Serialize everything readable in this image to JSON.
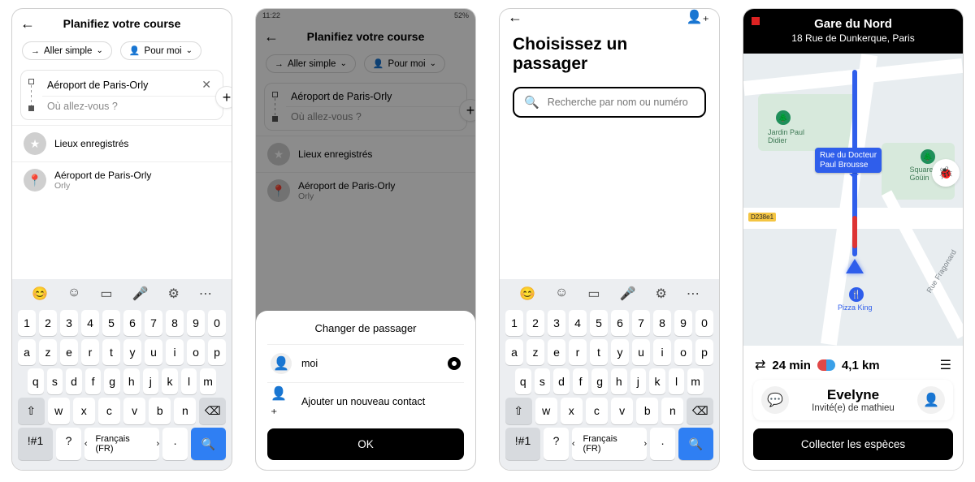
{
  "screen1": {
    "title": "Planifiez votre course",
    "chip_trip": "Aller simple",
    "chip_rider": "Pour moi",
    "origin": "Aéroport de Paris-Orly",
    "dest_placeholder": "Où allez-vous ?",
    "saved_places": "Lieux enregistrés",
    "suggestion_title": "Aéroport de Paris-Orly",
    "suggestion_sub": "Orly"
  },
  "screen2": {
    "status_time": "11:22",
    "status_right": "52%",
    "title": "Planifiez votre course",
    "chip_trip": "Aller simple",
    "chip_rider": "Pour moi",
    "origin": "Aéroport de Paris-Orly",
    "dest_placeholder": "Où allez-vous ?",
    "saved_places": "Lieux enregistrés",
    "suggestion_title": "Aéroport de Paris-Orly",
    "suggestion_sub": "Orly",
    "sheet_title": "Changer de passager",
    "opt_me": "moi",
    "opt_add": "Ajouter un nouveau contact",
    "ok": "OK"
  },
  "screen3": {
    "title": "Choisissez un passager",
    "search_placeholder": "Recherche par nom ou numéro"
  },
  "screen4": {
    "addr_title": "Gare du Nord",
    "addr_sub": "18 Rue de Dunkerque, Paris",
    "street_pill_l1": "Rue du Docteur",
    "street_pill_l2": "Paul Brousse",
    "park1": "Jardin Paul",
    "park1b": "Didier",
    "park2": "Square Ernest",
    "park2b": "Goüin",
    "roadsign": "D238e1",
    "poi_food": "Pizza King",
    "road_right": "Rue Fragonard",
    "eta": "24 min",
    "dist": "4,1 km",
    "guest_name": "Evelyne",
    "guest_sub": "Invité(e) de mathieu",
    "collect": "Collecter les espèces"
  },
  "keyboard": {
    "row_num": [
      "1",
      "2",
      "3",
      "4",
      "5",
      "6",
      "7",
      "8",
      "9",
      "0"
    ],
    "row_a": [
      "a",
      "z",
      "e",
      "r",
      "t",
      "y",
      "u",
      "i",
      "o",
      "p"
    ],
    "row_q": [
      "q",
      "s",
      "d",
      "f",
      "g",
      "h",
      "j",
      "k",
      "l",
      "m"
    ],
    "row_w": [
      "w",
      "x",
      "c",
      "v",
      "b",
      "n"
    ],
    "sym": "!#1",
    "qmark": "?",
    "lang": "Français (FR)",
    "dot": "."
  }
}
